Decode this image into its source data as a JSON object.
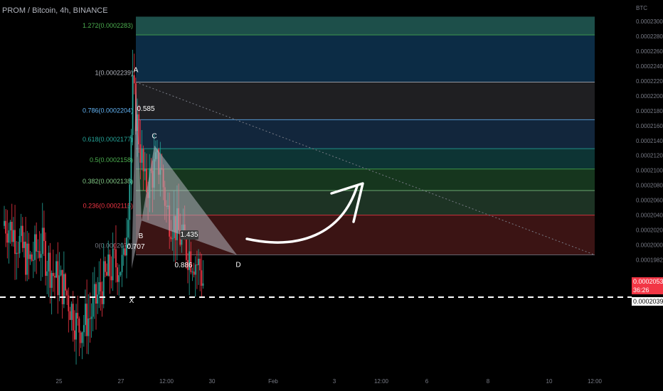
{
  "header": {
    "title": "PROM / Bitcoin, 4h, BINANCE"
  },
  "chart_data": {
    "type": "candlestick",
    "title": "PROM / Bitcoin, 4h, BINANCE",
    "y_axis_unit": "BTC",
    "ylim": [
      0.000198,
      0.00023
    ],
    "y_ticks": [
      "0.0002300",
      "0.0002280",
      "0.0002260",
      "0.0002240",
      "0.0002220",
      "0.0002200",
      "0.0002180",
      "0.0002160",
      "0.0002140",
      "0.0002120",
      "0.0002100",
      "0.0002080",
      "0.0002060",
      "0.0002040",
      "0.0002020",
      "0.0002000",
      "0.0001982"
    ],
    "x_ticks": [
      "25",
      "27",
      "12:00",
      "30",
      "Feb",
      "3",
      "12:00",
      "6",
      "8",
      "10",
      "12:00"
    ],
    "fib_levels": [
      {
        "label": "1.272(0.0002283)",
        "value": 0.0002283,
        "color": "#4caf50"
      },
      {
        "label": "1(0.0002239)",
        "value": 0.0002239,
        "color": "#b2b5be"
      },
      {
        "label": "0.786(0.0002204)",
        "value": 0.0002204,
        "color": "#64b5f6"
      },
      {
        "label": "0.618(0.0002177)",
        "value": 0.0002177,
        "color": "#26a69a"
      },
      {
        "label": "0.5(0.0002158)",
        "value": 0.0002158,
        "color": "#4caf50"
      },
      {
        "label": "0.382(0.0002138)",
        "value": 0.0002138,
        "color": "#81c784"
      },
      {
        "label": "0.236(0.0002115)",
        "value": 0.0002115,
        "color": "#f23645"
      },
      {
        "label": "0(0.0002078)",
        "value": 0.0002078,
        "color": "#787b86"
      }
    ],
    "pattern_points": [
      {
        "label": "X",
        "value": 0.0002065
      },
      {
        "label": "A",
        "value": 0.0002239
      },
      {
        "label": "B",
        "value": 0.000211
      },
      {
        "label": "C",
        "value": 0.000218
      },
      {
        "label": "D",
        "value": 0.0002078
      }
    ],
    "pattern_ratios": [
      "0.585",
      "0.707",
      "1.435",
      "0.886"
    ],
    "current_price": {
      "value": "0.0002053",
      "countdown": "36:26"
    },
    "support_line": {
      "value": "0.0002039"
    }
  },
  "colors": {
    "bull": "#26a69a",
    "bear": "#f23645",
    "background": "#000000"
  }
}
